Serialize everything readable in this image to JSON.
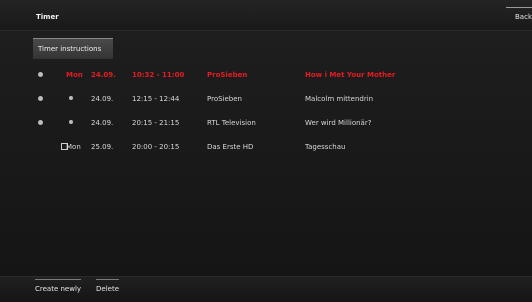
{
  "header": {
    "title": "Timer",
    "back_label": "Back"
  },
  "instructions_button": "Timer instructions",
  "rows": [
    {
      "day": "Mon",
      "date": "24.09.",
      "time": "10:32 - 11:00",
      "channel": "ProSieben",
      "program": "How i Met Your Mother",
      "active": true
    },
    {
      "day": "",
      "date": "24.09.",
      "time": "12:15 - 12:44",
      "channel": "ProSieben",
      "program": "Malcolm mittendrin",
      "active": false
    },
    {
      "day": "",
      "date": "24.09.",
      "time": "20:15 - 21:15",
      "channel": "RTL Television",
      "program": "Wer wird Millionär?",
      "active": false
    },
    {
      "day": "Mon",
      "date": "25.09.",
      "time": "20:00 - 20:15",
      "channel": "Das Erste HD",
      "program": "Tagesschau",
      "active": false
    }
  ],
  "footer": {
    "create_label": "Create newly",
    "delete_label": "Delete"
  },
  "colors": {
    "active_text": "#e51b24",
    "background": "#151515"
  }
}
